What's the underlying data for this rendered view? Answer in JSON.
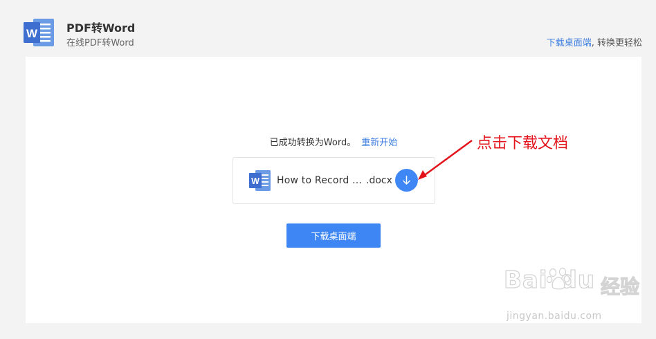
{
  "header": {
    "title": "PDF转Word",
    "subtitle": "在线PDF转Word",
    "download_link": "下载桌面端",
    "download_tagline": ", 转换更轻松"
  },
  "result": {
    "status": "已成功转换为Word。",
    "restart": "重新开始"
  },
  "file": {
    "name": "How to Record ...",
    "ext": ".docx"
  },
  "main_button": "下载桌面端",
  "annotation": "点击下载文档",
  "watermark": {
    "brand": "Bai",
    "brand_suffix": "du",
    "cn": "经验",
    "url": "jingyan.baidu.com"
  },
  "colors": {
    "accent": "#3f87f5",
    "link": "#3f7fe0",
    "annotation": "#e3131b",
    "word_blue": "#4a7dd6"
  }
}
